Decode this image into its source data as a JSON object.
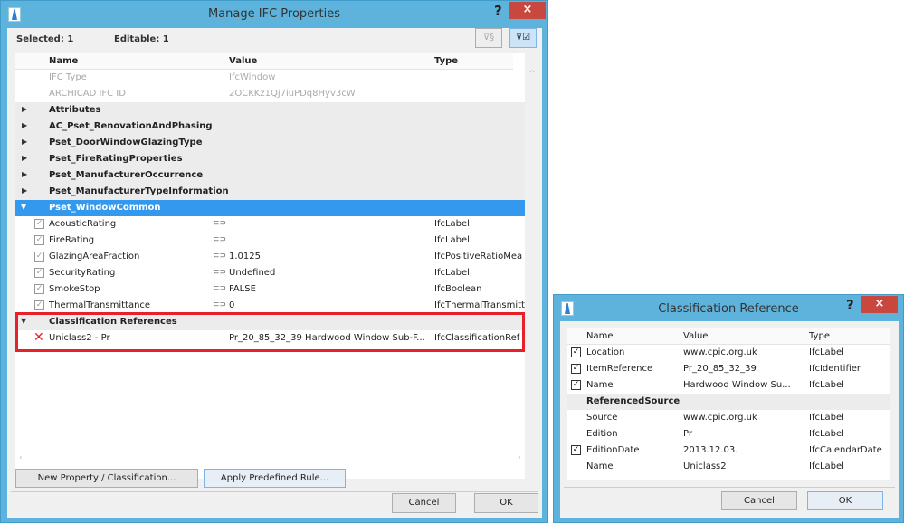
{
  "main": {
    "title": "Manage IFC Properties",
    "help": "?",
    "close": "×",
    "selected": "Selected: 1",
    "editable": "Editable: 1",
    "columns": {
      "name": "Name",
      "value": "Value",
      "type": "Type"
    },
    "info_rows": [
      {
        "name": "IFC Type",
        "value": "IfcWindow"
      },
      {
        "name": "ARCHICAD IFC ID",
        "value": "2OCKKz1Qj7iuPDq8Hyv3cW"
      }
    ],
    "groups": [
      "Attributes",
      "AC_Pset_RenovationAndPhasing",
      "Pset_DoorWindowGlazingType",
      "Pset_FireRatingProperties",
      "Pset_ManufacturerOccurrence",
      "Pset_ManufacturerTypeInformation"
    ],
    "selected_group": "Pset_WindowCommon",
    "properties": [
      {
        "name": "AcousticRating",
        "value": "",
        "type": "IfcLabel"
      },
      {
        "name": "FireRating",
        "value": "",
        "type": "IfcLabel"
      },
      {
        "name": "GlazingAreaFraction",
        "value": "1.0125",
        "type": "IfcPositiveRatioMea"
      },
      {
        "name": "SecurityRating",
        "value": "Undefined",
        "type": "IfcLabel"
      },
      {
        "name": "SmokeStop",
        "value": "FALSE",
        "type": "IfcBoolean"
      },
      {
        "name": "ThermalTransmittance",
        "value": "0",
        "type": "IfcThermalTransmitt"
      }
    ],
    "classification_group": "Classification References",
    "classification": {
      "name": "Uniclass2 - Pr",
      "value": "Pr_20_85_32_39 Hardwood Window Sub-F...",
      "type": "IfcClassificationRef"
    },
    "new_button": "New Property / Classification...",
    "apply_button": "Apply Predefined Rule...",
    "cancel": "Cancel",
    "ok": "OK",
    "highlight_color": "#e8202a"
  },
  "classref": {
    "title": "Classification Reference",
    "help": "?",
    "close": "×",
    "columns": {
      "name": "Name",
      "value": "Value",
      "type": "Type"
    },
    "rows": [
      {
        "checked": true,
        "name": "Location",
        "value": "www.cpic.org.uk",
        "type": "IfcLabel"
      },
      {
        "checked": true,
        "name": "ItemReference",
        "value": "Pr_20_85_32_39",
        "type": "IfcIdentifier"
      },
      {
        "checked": true,
        "name": "Name",
        "value": "Hardwood Window Su...",
        "type": "IfcLabel"
      }
    ],
    "source_group": "ReferencedSource",
    "source_rows": [
      {
        "checked": false,
        "name": "Source",
        "value": "www.cpic.org.uk",
        "type": "IfcLabel"
      },
      {
        "checked": false,
        "name": "Edition",
        "value": "Pr",
        "type": "IfcLabel"
      },
      {
        "checked": true,
        "name": "EditionDate",
        "value": "2013.12.03.",
        "type": "IfcCalendarDate"
      },
      {
        "checked": false,
        "name": "Name",
        "value": "Uniclass2",
        "type": "IfcLabel"
      }
    ],
    "cancel": "Cancel",
    "ok": "OK"
  }
}
